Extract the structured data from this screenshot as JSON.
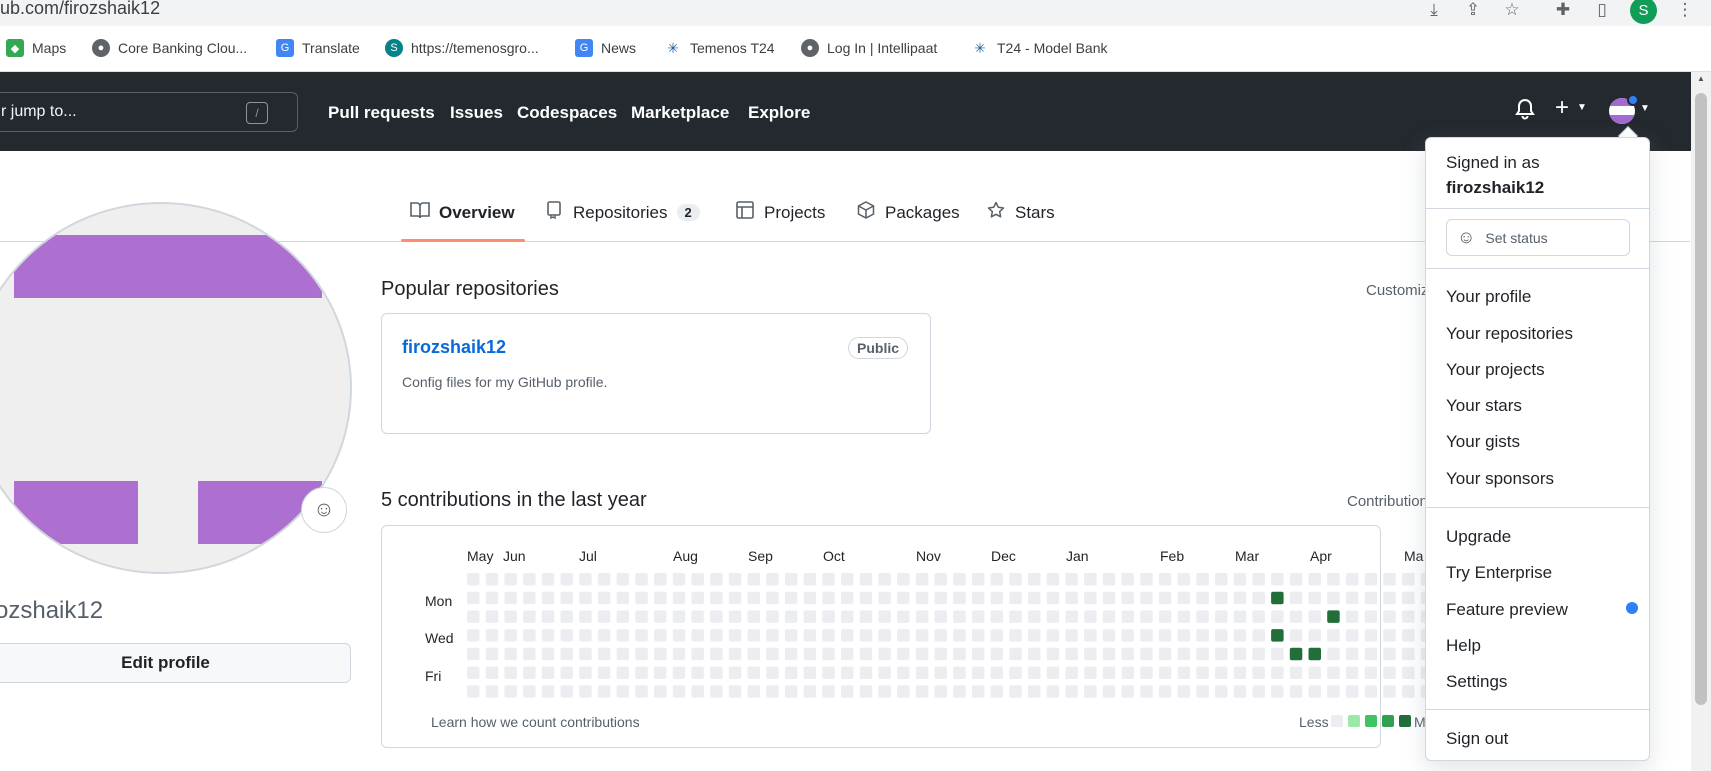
{
  "browser": {
    "url": "ub.com/firozshaik12",
    "profile_initial": "S",
    "icons": [
      "download-icon",
      "share-icon",
      "star-icon",
      "extensions-icon",
      "sidebar-icon",
      "profile-icon",
      "more-icon"
    ],
    "bookmarks": [
      {
        "label": "Maps",
        "icon": "maps-icon",
        "color": "#34a853"
      },
      {
        "label": "Core Banking Clou...",
        "icon": "globe-icon",
        "color": "#5f6368"
      },
      {
        "label": "Translate",
        "icon": "translate-icon",
        "color": "#4285f4"
      },
      {
        "label": "https://temenosgro...",
        "icon": "sharepoint-icon",
        "color": "#038387"
      },
      {
        "label": "News",
        "icon": "news-icon",
        "color": "#4285f4"
      },
      {
        "label": "Temenos T24",
        "icon": "temenos-icon",
        "color": "#1c5d99"
      },
      {
        "label": "Log In | Intellipaat",
        "icon": "globe-icon",
        "color": "#5f6368"
      },
      {
        "label": "T24 - Model Bank",
        "icon": "temenos-icon",
        "color": "#1c5d99"
      }
    ]
  },
  "header": {
    "search_placeholder": "r jump to...",
    "search_key": "/",
    "nav": [
      "Pull requests",
      "Issues",
      "Codespaces",
      "Marketplace",
      "Explore"
    ],
    "bell_icon": "bell-icon",
    "plus_icon": "plus-icon"
  },
  "tabs": [
    {
      "label": "Overview",
      "icon": "book-icon",
      "selected": true
    },
    {
      "label": "Repositories",
      "icon": "repo-icon",
      "count": "2"
    },
    {
      "label": "Projects",
      "icon": "table-icon"
    },
    {
      "label": "Packages",
      "icon": "package-icon"
    },
    {
      "label": "Stars",
      "icon": "star-icon"
    }
  ],
  "profile": {
    "username": "ozshaik12",
    "edit_label": "Edit profile"
  },
  "popular": {
    "title": "Popular repositories",
    "customize": "Customiz",
    "repo": {
      "name": "firozshaik12",
      "badge": "Public",
      "description": "Config files for my GitHub profile."
    }
  },
  "contributions": {
    "title": "5 contributions in the last year",
    "settings": "Contribution",
    "months": [
      "May",
      "Jun",
      "Jul",
      "Aug",
      "Sep",
      "Oct",
      "Nov",
      "Dec",
      "Jan",
      "Feb",
      "Mar",
      "Apr",
      "Ma"
    ],
    "days": [
      "Mon",
      "Wed",
      "Fri"
    ],
    "learn": "Learn how we count contributions",
    "legend_less": "Less",
    "legend_more": "M",
    "colors": {
      "empty": "#ebedf0",
      "l1": "#9be9a8",
      "l2": "#40c463",
      "l3": "#30a14e",
      "l4": "#216e39"
    }
  },
  "dropdown": {
    "signed_in_as": "Signed in as",
    "user": "firozshaik12",
    "set_status": "Set status",
    "group1": [
      "Your profile",
      "Your repositories",
      "Your projects",
      "Your stars",
      "Your gists",
      "Your sponsors"
    ],
    "group2": [
      "Upgrade",
      "Try Enterprise",
      "Feature preview",
      "Help",
      "Settings"
    ],
    "sign_out": "Sign out"
  }
}
